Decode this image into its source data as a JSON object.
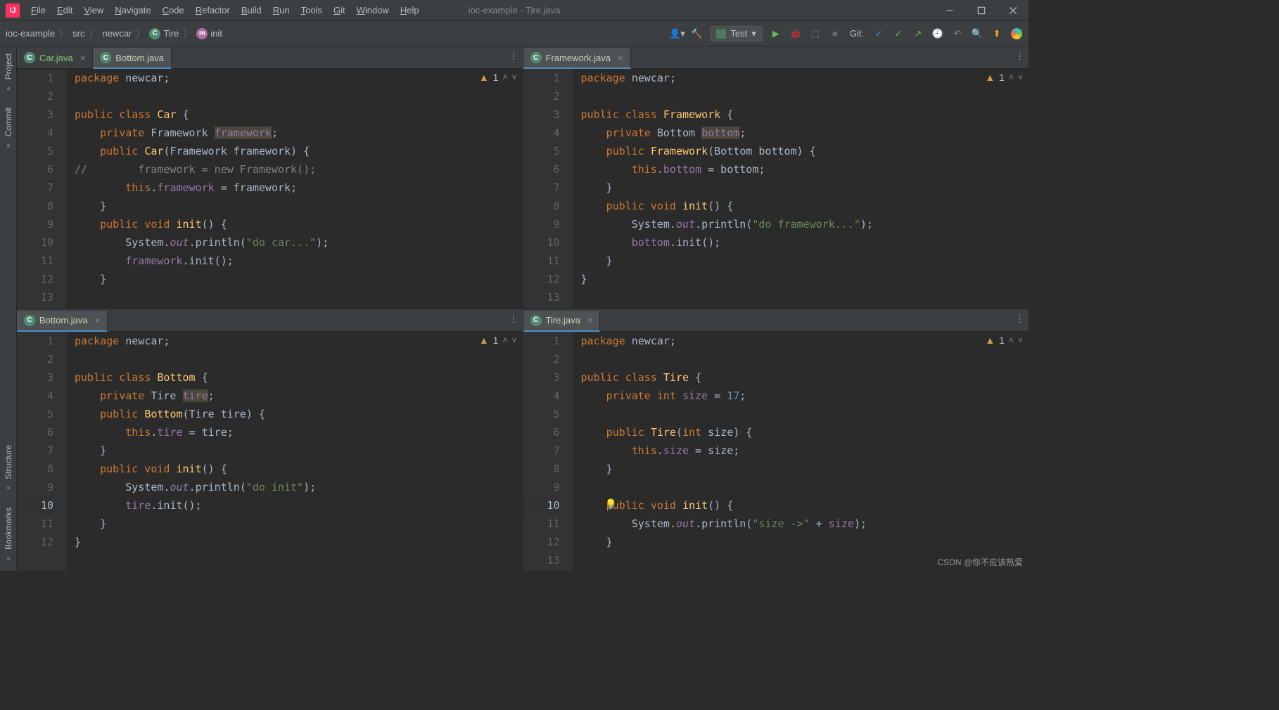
{
  "window": {
    "title": "ioc-example - Tire.java"
  },
  "menu": [
    "File",
    "Edit",
    "View",
    "Navigate",
    "Code",
    "Refactor",
    "Build",
    "Run",
    "Tools",
    "Git",
    "Window",
    "Help"
  ],
  "breadcrumb": {
    "items": [
      {
        "label": "ioc-example"
      },
      {
        "label": "src"
      },
      {
        "label": "newcar"
      },
      {
        "label": "Tire",
        "icon": "class"
      },
      {
        "label": "init",
        "icon": "method"
      }
    ]
  },
  "runConfig": {
    "label": "Test"
  },
  "git": {
    "label": "Git:"
  },
  "toolstrip": [
    {
      "label": "Project",
      "icon": "folder"
    },
    {
      "label": "Commit",
      "icon": "commit"
    },
    {
      "label": "Structure",
      "icon": "structure"
    },
    {
      "label": "Bookmarks",
      "icon": "bookmark"
    }
  ],
  "panes": [
    {
      "id": "top-left",
      "tabs": [
        {
          "label": "Car.java",
          "active": false,
          "special": true,
          "closable": true
        },
        {
          "label": "Bottom.java",
          "active": true,
          "closable": false
        }
      ],
      "warning": "1",
      "code": [
        {
          "n": 1,
          "html": "<span class='kw'>package</span> newcar;"
        },
        {
          "n": 2,
          "html": ""
        },
        {
          "n": 3,
          "html": "<span class='kw'>public class</span> <span class='fname'>Car</span> {"
        },
        {
          "n": 4,
          "html": "    <span class='kw'>private</span> Framework <span class='fld hi'>framework</span>;"
        },
        {
          "n": 5,
          "html": "    <span class='kw'>public</span> <span class='fname'>Car</span>(Framework framework) {"
        },
        {
          "n": 6,
          "html": "<span class='cmt'>//        framework = new Framework();</span>"
        },
        {
          "n": 7,
          "html": "        <span class='kw'>this</span>.<span class='fld'>framework</span> = framework;"
        },
        {
          "n": 8,
          "html": "    }"
        },
        {
          "n": 9,
          "html": "    <span class='kw'>public void</span> <span class='fname'>init</span>() {"
        },
        {
          "n": 10,
          "html": "        System.<span class='it'>out</span>.println(<span class='str'>\"do car...\"</span>);"
        },
        {
          "n": 11,
          "html": "        <span class='fld'>framework</span>.init();"
        },
        {
          "n": 12,
          "html": "    }"
        },
        {
          "n": 13,
          "html": ""
        }
      ]
    },
    {
      "id": "top-right",
      "tabs": [
        {
          "label": "Framework.java",
          "active": true,
          "closable": true
        }
      ],
      "warning": "1",
      "code": [
        {
          "n": 1,
          "html": "<span class='kw'>package</span> newcar;"
        },
        {
          "n": 2,
          "html": ""
        },
        {
          "n": 3,
          "html": "<span class='kw'>public class</span> <span class='fname'>Framework</span> {"
        },
        {
          "n": 4,
          "html": "    <span class='kw'>private</span> Bottom <span class='fld hi'>bottom</span>;"
        },
        {
          "n": 5,
          "html": "    <span class='kw'>public</span> <span class='fname'>Framework</span>(Bottom bottom) {"
        },
        {
          "n": 6,
          "html": "        <span class='kw'>this</span>.<span class='fld'>bottom</span> = bottom;"
        },
        {
          "n": 7,
          "html": "    }"
        },
        {
          "n": 8,
          "html": "    <span class='kw'>public void</span> <span class='fname'>init</span>() {"
        },
        {
          "n": 9,
          "html": "        System.<span class='it'>out</span>.println(<span class='str'>\"do framework...\"</span>);"
        },
        {
          "n": 10,
          "html": "        <span class='fld'>bottom</span>.init();"
        },
        {
          "n": 11,
          "html": "    }"
        },
        {
          "n": 12,
          "html": "}"
        },
        {
          "n": 13,
          "html": ""
        }
      ]
    },
    {
      "id": "bottom-left",
      "tabs": [
        {
          "label": "Bottom.java",
          "active": true,
          "closable": true
        }
      ],
      "warning": "1",
      "code": [
        {
          "n": 1,
          "html": "<span class='kw'>package</span> newcar;"
        },
        {
          "n": 2,
          "html": ""
        },
        {
          "n": 3,
          "html": "<span class='kw'>public class</span> <span class='fname'>Bottom</span> {"
        },
        {
          "n": 4,
          "html": "    <span class='kw'>private</span> Tire <span class='fld hi'>tire</span>;"
        },
        {
          "n": 5,
          "html": "    <span class='kw'>public</span> <span class='fname'>Bottom</span>(Tire tire) {"
        },
        {
          "n": 6,
          "html": "        <span class='kw'>this</span>.<span class='fld'>tire</span> = tire;"
        },
        {
          "n": 7,
          "html": "    }"
        },
        {
          "n": 8,
          "html": "    <span class='kw'>public void</span> <span class='fname'>init</span>() {"
        },
        {
          "n": 9,
          "html": "        System.<span class='it'>out</span>.println(<span class='str'>\"do init\"</span>);"
        },
        {
          "n": 10,
          "html": "        <span class='fld'>tire</span>.init();",
          "marked": true
        },
        {
          "n": 11,
          "html": "    }"
        },
        {
          "n": 12,
          "html": "}"
        }
      ]
    },
    {
      "id": "bottom-right",
      "tabs": [
        {
          "label": "Tire.java",
          "active": true,
          "closable": true
        }
      ],
      "warning": "1",
      "bulbLine": 10,
      "code": [
        {
          "n": 1,
          "html": "<span class='kw'>package</span> newcar;"
        },
        {
          "n": 2,
          "html": ""
        },
        {
          "n": 3,
          "html": "<span class='kw'>public class</span> <span class='fname'>Tire</span> {"
        },
        {
          "n": 4,
          "html": "    <span class='kw'>private int</span> <span class='fld'>size</span> = <span class='num'>17</span>;"
        },
        {
          "n": 5,
          "html": ""
        },
        {
          "n": 6,
          "html": "    <span class='kw'>public</span> <span class='fname'>Tire</span>(<span class='kw'>int</span> size) {"
        },
        {
          "n": 7,
          "html": "        <span class='kw'>this</span>.<span class='fld'>size</span> = size;"
        },
        {
          "n": 8,
          "html": "    }"
        },
        {
          "n": 9,
          "html": ""
        },
        {
          "n": 10,
          "html": "    <span class='kw'>public void</span> <span class='fname'>init</span>() {",
          "marked": true
        },
        {
          "n": 11,
          "html": "        System.<span class='it'>out</span>.println(<span class='str'>\"size ->\"</span> + <span class='fld'>size</span>);"
        },
        {
          "n": 12,
          "html": "    }"
        },
        {
          "n": 13,
          "html": ""
        }
      ]
    }
  ],
  "watermark": "CSDN @你不应该热爱"
}
